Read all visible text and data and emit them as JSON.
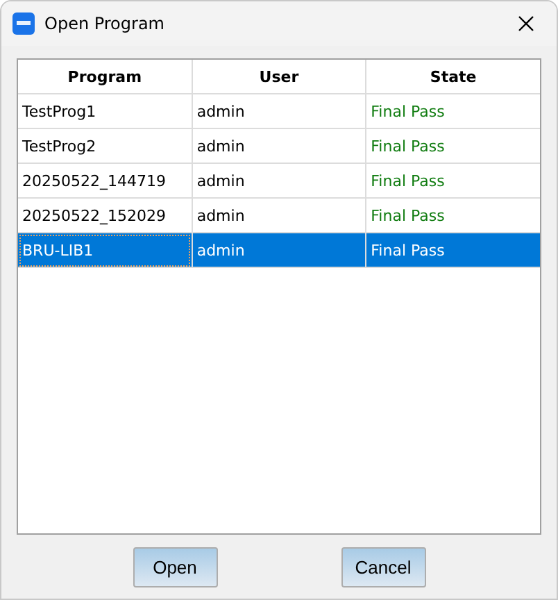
{
  "window": {
    "title": "Open Program"
  },
  "table": {
    "columns": [
      "Program",
      "User",
      "State"
    ],
    "rows": [
      {
        "cells": [
          "TestProg1",
          "admin",
          "Final Pass"
        ],
        "selected": false
      },
      {
        "cells": [
          "TestProg2",
          "admin",
          "Final Pass"
        ],
        "selected": false
      },
      {
        "cells": [
          "20250522_144719",
          "admin",
          "Final Pass"
        ],
        "selected": false
      },
      {
        "cells": [
          "20250522_152029",
          "admin",
          "Final Pass"
        ],
        "selected": false
      },
      {
        "cells": [
          "BRU-LIB1",
          "admin",
          "Final Pass"
        ],
        "selected": true
      }
    ]
  },
  "buttons": [
    "Open",
    "Cancel"
  ]
}
